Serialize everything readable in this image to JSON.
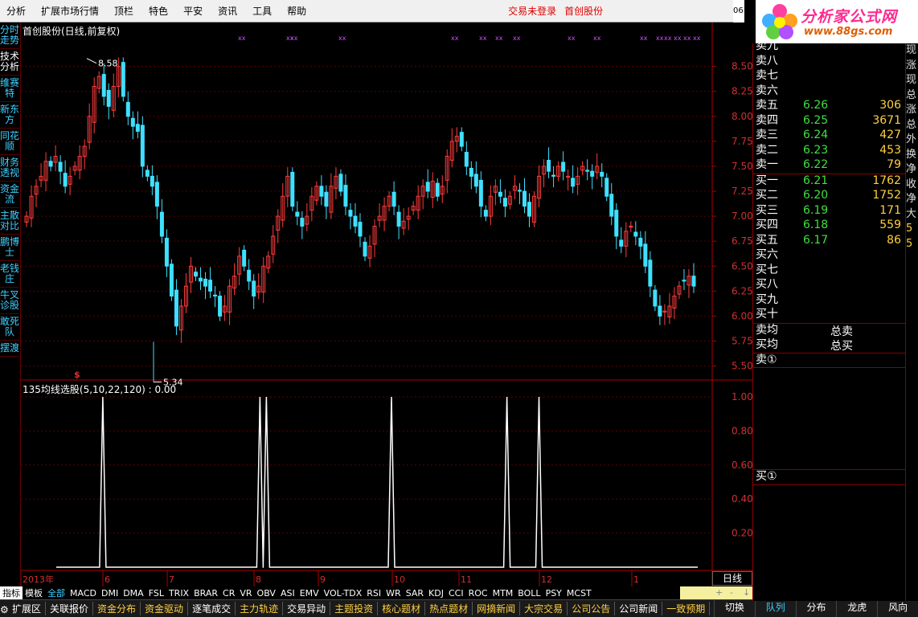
{
  "menubar": {
    "items": [
      "分析",
      "扩展市场行情",
      "顶栏",
      "特色",
      "平安",
      "资讯",
      "工具",
      "帮助"
    ],
    "status_trade": "交易未登录",
    "status_stock": "首创股份",
    "clock": "06"
  },
  "logo": {
    "title": "分析家公式网",
    "url_text": "www.88gs.com"
  },
  "leftnav": [
    "分时走势",
    "技术分析",
    "维赛特",
    "新东方",
    "同花顺",
    "财务透视",
    "资金流",
    "主散对比",
    "鹏博士",
    "老钱庄",
    "牛叉诊股",
    "敢死队",
    "摆渡"
  ],
  "chart_title": "首创股份(日线,前复权)",
  "indicator_title": "135均线选股(5,10,22,120) : 0.00",
  "x_year_label": "2013年",
  "high_marker": "8.58",
  "low_marker": "5.34",
  "dollar_marker": "$",
  "chart_data": [
    {
      "type": "candlestick",
      "title": "首创股份(日线,前复权)",
      "y_ticks": [
        "8.50",
        "8.25",
        "8.00",
        "7.75",
        "7.50",
        "7.25",
        "7.00",
        "6.75",
        "6.50",
        "6.25",
        "6.00",
        "5.75",
        "5.50"
      ],
      "ylim": [
        5.4,
        8.65
      ],
      "x_ticks": [
        "2013年",
        "6",
        "7",
        "8",
        "9",
        "10",
        "11",
        "12",
        "1"
      ],
      "high": 8.58,
      "low": 5.34,
      "colors": {
        "up": "#ff3c3c",
        "down": "#3fe0ff"
      },
      "series": [
        {
          "values": [
            7.0,
            7.2,
            7.3,
            7.4,
            7.55,
            7.5,
            7.6,
            7.45,
            7.3,
            7.4,
            7.5,
            7.6,
            7.7,
            8.0,
            8.3,
            8.4,
            8.2,
            8.1,
            8.3,
            8.5,
            8.2,
            8.0,
            7.9,
            7.85,
            7.5,
            7.4,
            7.3,
            7.1,
            6.8,
            6.5,
            6.2,
            5.9,
            6.1,
            6.3,
            6.5,
            6.4,
            6.35,
            6.3,
            6.25,
            6.2,
            6.0,
            6.1,
            6.3,
            6.4,
            6.6,
            6.5,
            6.35,
            6.2,
            6.3,
            6.5,
            6.6,
            6.8,
            7.0,
            7.2,
            7.4,
            7.1,
            7.0,
            6.9,
            7.0,
            7.2,
            7.3,
            7.2,
            7.1,
            7.3,
            7.4,
            7.25,
            7.1,
            7.0,
            6.9,
            6.8,
            6.6,
            6.7,
            6.9,
            7.0,
            7.1,
            7.2,
            7.1,
            6.9,
            6.95,
            7.0,
            7.1,
            7.2,
            7.3,
            7.25,
            7.35,
            7.2,
            7.3,
            7.6,
            7.75,
            7.8,
            7.7,
            7.5,
            7.4,
            7.3,
            7.1,
            7.0,
            7.2,
            7.3,
            7.2,
            7.1,
            7.2,
            7.3,
            7.25,
            7.1,
            7.0,
            7.2,
            7.4,
            7.5,
            7.45,
            7.4,
            7.5,
            7.45,
            7.4,
            7.3,
            7.4,
            7.5,
            7.45,
            7.4,
            7.5,
            7.4,
            7.2,
            7.0,
            6.8,
            6.7,
            6.85,
            6.9,
            6.8,
            6.7,
            6.5,
            6.3,
            6.1,
            6.0,
            6.05,
            6.1,
            6.2,
            6.3,
            6.35,
            6.4,
            6.3
          ]
        }
      ]
    },
    {
      "type": "line",
      "title": "135均线选股(5,10,22,120)",
      "y_ticks": [
        "1.00",
        "0.80",
        "0.60",
        "0.40",
        "0.20"
      ],
      "ylim": [
        0,
        1.0
      ],
      "spikes_at": [
        0.06,
        0.305,
        0.315,
        0.51,
        0.69,
        0.74
      ],
      "color": "#ffffff"
    }
  ],
  "markers_top": "xx",
  "order_book": {
    "sells": [
      {
        "label": "卖九",
        "price": "",
        "vol": ""
      },
      {
        "label": "卖八",
        "price": "",
        "vol": ""
      },
      {
        "label": "卖七",
        "price": "",
        "vol": ""
      },
      {
        "label": "卖六",
        "price": "",
        "vol": ""
      },
      {
        "label": "卖五",
        "price": "6.26",
        "vol": "306"
      },
      {
        "label": "卖四",
        "price": "6.25",
        "vol": "3671"
      },
      {
        "label": "卖三",
        "price": "6.24",
        "vol": "427"
      },
      {
        "label": "卖二",
        "price": "6.23",
        "vol": "453"
      },
      {
        "label": "卖一",
        "price": "6.22",
        "vol": "79"
      }
    ],
    "buys": [
      {
        "label": "买一",
        "price": "6.21",
        "vol": "1762"
      },
      {
        "label": "买二",
        "price": "6.20",
        "vol": "1752"
      },
      {
        "label": "买三",
        "price": "6.19",
        "vol": "171"
      },
      {
        "label": "买四",
        "price": "6.18",
        "vol": "559"
      },
      {
        "label": "买五",
        "price": "6.17",
        "vol": "86"
      },
      {
        "label": "买六",
        "price": "",
        "vol": ""
      },
      {
        "label": "买七",
        "price": "",
        "vol": ""
      },
      {
        "label": "买八",
        "price": "",
        "vol": ""
      },
      {
        "label": "买九",
        "price": "",
        "vol": ""
      },
      {
        "label": "买十",
        "price": "",
        "vol": ""
      }
    ],
    "avg_sell": "卖均",
    "avg_buy": "买均",
    "total_sell": "总卖",
    "total_buy": "总买",
    "sell1_label": "卖①",
    "buy1_label": "买①"
  },
  "farright": [
    "现",
    "涨",
    "现",
    "总",
    "涨",
    "总",
    "外",
    "换",
    "净",
    "收",
    "净",
    "大",
    "5",
    "5"
  ],
  "day_tab": "日线",
  "bottom_tabs": [
    "指标",
    "模板",
    "全部",
    "MACD",
    "DMI",
    "DMA",
    "FSL",
    "TRIX",
    "BRAR",
    "CR",
    "VR",
    "OBV",
    "ASI",
    "EMV",
    "VOL-TDX",
    "RSI",
    "WR",
    "SAR",
    "KDJ",
    "CCI",
    "ROC",
    "MTM",
    "BOLL",
    "PSY",
    "MCST"
  ],
  "statusbar": [
    "扩展区",
    "关联报价",
    "资金分布",
    "资金驱动",
    "逐笔成交",
    "主力轨迹",
    "交易异动",
    "主题投资",
    "核心题材",
    "热点题材",
    "网摘新闻",
    "大宗交易",
    "公司公告",
    "公司新闻",
    "一致预期"
  ],
  "right_tabs": [
    "切换",
    "队列",
    "分布",
    "龙虎",
    "风向"
  ],
  "yellowbar_marks": [
    "+",
    "-",
    "↓"
  ]
}
